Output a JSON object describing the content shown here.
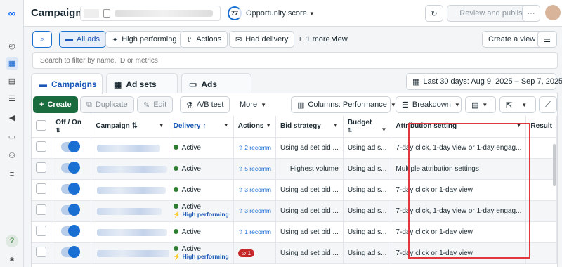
{
  "header": {
    "title": "Campaigns",
    "opportunity_score": "77",
    "opportunity_label": "Opportunity score",
    "review_label": "Review and publish",
    "more_label": "···"
  },
  "views": {
    "all_ads": "All ads",
    "high_performing": "High performing",
    "actions": "Actions",
    "had_delivery": "Had delivery",
    "more_view": "1 more view",
    "create_view": "Create a view"
  },
  "search": {
    "placeholder": "Search to filter by name, ID or metrics"
  },
  "tabs": {
    "campaigns": "Campaigns",
    "ad_sets": "Ad sets",
    "ads": "Ads"
  },
  "date_range": "Last 30 days: Aug 9, 2025 – Sep 7, 2025",
  "toolbar": {
    "create": "Create",
    "duplicate": "Duplicate",
    "edit": "Edit",
    "ab_test": "A/B test",
    "more": "More",
    "columns": "Columns: Performance",
    "breakdown": "Breakdown"
  },
  "columns": {
    "off_on": "Off / On",
    "campaign": "Campaign",
    "delivery": "Delivery",
    "actions": "Actions",
    "bid_strategy": "Bid strategy",
    "budget": "Budget",
    "attribution": "Attribution setting",
    "results": "Result"
  },
  "rows": [
    {
      "delivery": "Active",
      "tag": "",
      "actions": "2 recomm",
      "bid": "Using ad set bid ...",
      "budget": "Using ad s...",
      "attribution": "7-day click, 1-day view or 1-day engag..."
    },
    {
      "delivery": "Active",
      "tag": "",
      "actions": "5 recomm",
      "bid": "Highest volume",
      "budget": "Using ad s...",
      "attribution": "Multiple attribution settings"
    },
    {
      "delivery": "Active",
      "tag": "",
      "actions": "3 recomm",
      "bid": "Using ad set bid ...",
      "budget": "Using ad s...",
      "attribution": "7-day click or 1-day view"
    },
    {
      "delivery": "Active",
      "tag": "High performing",
      "actions": "3 recomm",
      "bid": "Using ad set bid ...",
      "budget": "Using ad s...",
      "attribution": "7-day click, 1-day view or 1-day engag..."
    },
    {
      "delivery": "Active",
      "tag": "",
      "actions": "1 recomm",
      "bid": "Using ad set bid ...",
      "budget": "Using ad s...",
      "attribution": "7-day click or 1-day view"
    },
    {
      "delivery": "Active",
      "tag": "High performing",
      "actions": "1",
      "bid": "Using ad set bid ...",
      "budget": "Using ad s...",
      "attribution": "7-day click or 1-day view"
    }
  ],
  "colors": {
    "accent": "#1a6fd3",
    "create": "#1a6b3d",
    "highlight": "#e0383e"
  }
}
